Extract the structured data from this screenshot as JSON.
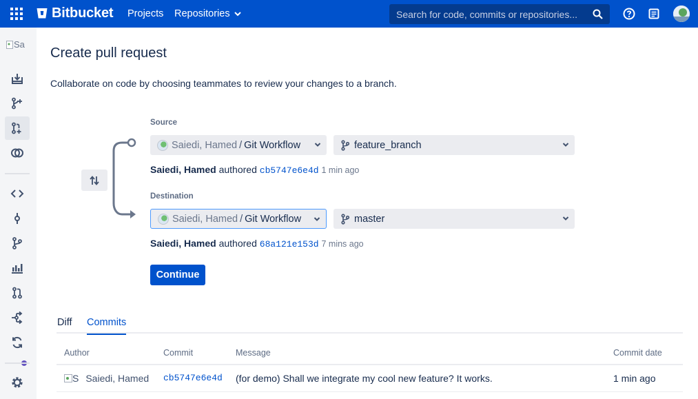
{
  "header": {
    "logo": "Bitbucket",
    "projects": "Projects",
    "repositories": "Repositories",
    "search_placeholder": "Search for code, commits or repositories..."
  },
  "sidebar": {
    "repo_avatar_alt": "Sa"
  },
  "page": {
    "title": "Create pull request",
    "description": "Collaborate on code by choosing teammates to review your changes to a branch."
  },
  "source": {
    "label": "Source",
    "owner": "Saiedi, Hamed",
    "repo": "Git Workflow",
    "branch": "feature_branch",
    "author": "Saiedi, Hamed",
    "authored_word": "authored",
    "hash": "cb5747e6e4d",
    "ago": "1 min ago"
  },
  "destination": {
    "label": "Destination",
    "owner": "Saiedi, Hamed",
    "repo": "Git Workflow",
    "branch": "master",
    "author": "Saiedi, Hamed",
    "authored_word": "authored",
    "hash": "68a121e153d",
    "ago": "7 mins ago"
  },
  "continue_label": "Continue",
  "tabs": [
    "Diff",
    "Commits"
  ],
  "table": {
    "headers": [
      "Author",
      "Commit",
      "Message",
      "Commit date"
    ],
    "rows": [
      {
        "avatar_alt": "S",
        "author": "Saiedi, Hamed",
        "commit": "cb5747e6e4d",
        "message": "(for demo) Shall we integrate my cool new feature? It works.",
        "date": "1 min ago"
      }
    ]
  },
  "colors": {
    "brand": "#0052cc",
    "sidebar_bg": "#f4f5f7",
    "notification_dot": "#6554c0"
  }
}
